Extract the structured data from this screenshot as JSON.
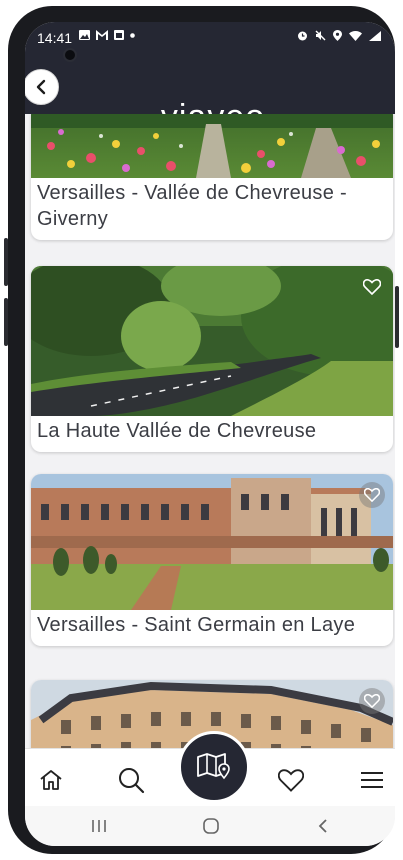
{
  "status": {
    "time": "14:41",
    "left_icons": [
      "image-icon",
      "gmail-icon",
      "calendar-icon",
      "dot-icon"
    ],
    "right_icons": [
      "alarm-icon",
      "mute-icon",
      "location-icon",
      "wifi-icon",
      "signal-icon"
    ]
  },
  "header": {
    "brand": "viaveo",
    "back_icon": "chevron-left-icon"
  },
  "cards": [
    {
      "title": "Versailles - Vallée de Chevreuse - Giverny"
    },
    {
      "title": "La Haute Vallée de Chevreuse"
    },
    {
      "title": "Versailles - Saint Germain en Laye"
    },
    {
      "title": ""
    }
  ],
  "nav": {
    "items": [
      "home-icon",
      "search-icon",
      "map-icon",
      "heart-icon",
      "menu-icon"
    ]
  },
  "system_nav": [
    "recents-icon",
    "home-circle-icon",
    "back-icon"
  ],
  "colors": {
    "header_bg": "#252733",
    "title_text": "#3b3d44",
    "background": "#f2f2f4"
  }
}
